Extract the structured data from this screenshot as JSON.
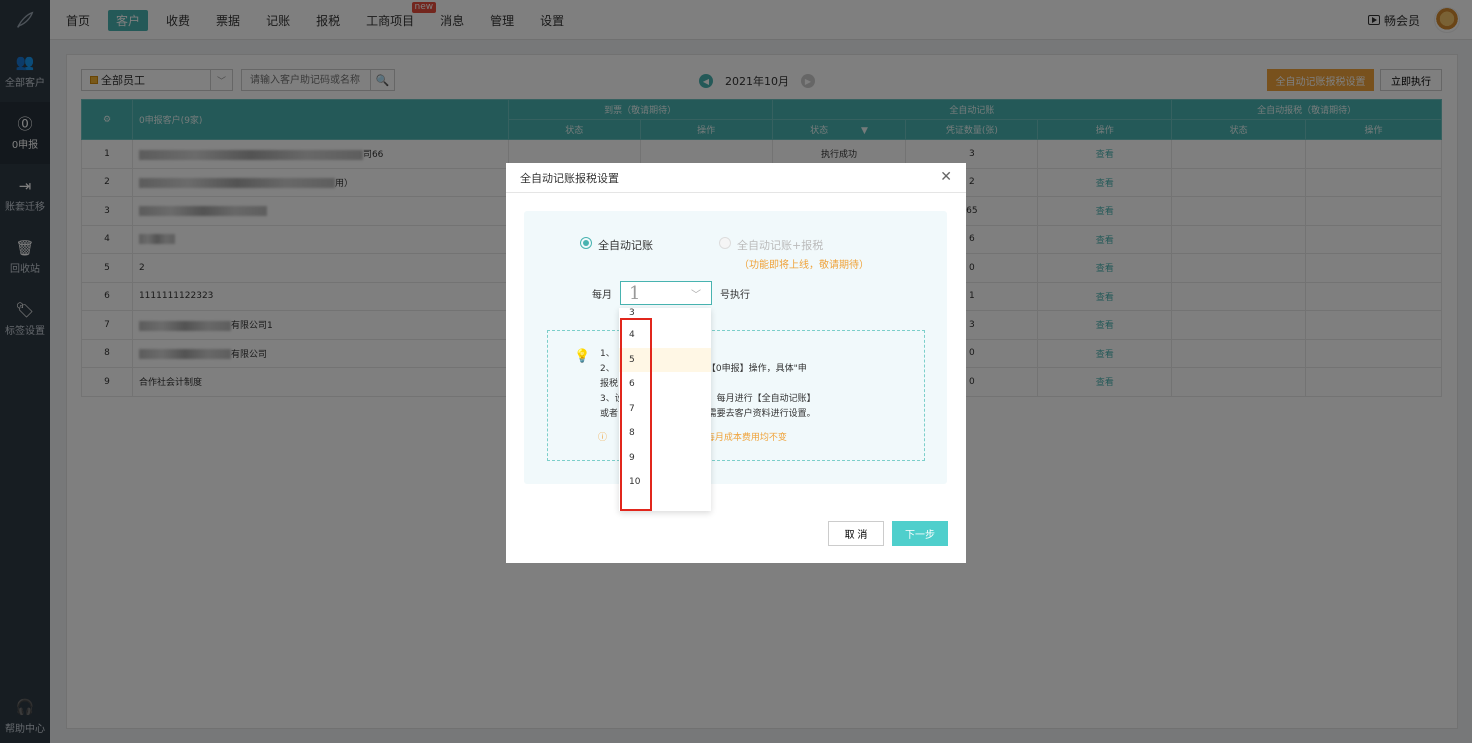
{
  "nav": {
    "items": [
      "首页",
      "客户",
      "收费",
      "票据",
      "记账",
      "报税",
      "工商项目",
      "消息",
      "管理",
      "设置"
    ],
    "active": "客户",
    "new_badge": "new",
    "vip_label": "畅会员"
  },
  "sidebar": {
    "items": [
      {
        "icon": "users-icon",
        "label": "全部客户"
      },
      {
        "icon": "zero-report-icon",
        "label": "0申报"
      },
      {
        "icon": "migrate-icon",
        "label": "账套迁移"
      },
      {
        "icon": "trash-icon",
        "label": "回收站"
      },
      {
        "icon": "tag-icon",
        "label": "标签设置"
      }
    ],
    "active": "0申报",
    "help_label": "帮助中心"
  },
  "toolbar": {
    "staff_select": "全部员工",
    "search_placeholder": "请输入客户助记码或名称",
    "month": "2021年10月",
    "auto_settings_btn": "全自动记账报税设置",
    "run_now_btn": "立即执行"
  },
  "table": {
    "group_headers": [
      "到票（敬请期待）",
      "全自动记账",
      "全自动报税（敬请期待）"
    ],
    "client_header": "0申报客户(9家)",
    "sub_headers": [
      "状态",
      "操作",
      "状态",
      "凭证数量(张)",
      "操作",
      "状态",
      "操作"
    ],
    "rows": [
      {
        "no": "1",
        "name_tail": "司66",
        "status": "执行成功",
        "count": "3",
        "action": "查看"
      },
      {
        "no": "2",
        "name_tail": "用）",
        "status": "",
        "count": "2",
        "action": "查看"
      },
      {
        "no": "3",
        "name_tail": "",
        "status": "",
        "count": "65",
        "action": "查看"
      },
      {
        "no": "4",
        "name_tail": "",
        "status": "",
        "count": "6",
        "action": "查看"
      },
      {
        "no": "5",
        "name_tail": "2",
        "status": "",
        "count": "0",
        "action": "查看"
      },
      {
        "no": "6",
        "name_tail": "1111111122323",
        "status": "",
        "count": "1",
        "action": "查看"
      },
      {
        "no": "7",
        "name_tail": "有限公司1",
        "status": "",
        "count": "3",
        "action": "查看"
      },
      {
        "no": "8",
        "name_tail": "有限公司",
        "status": "",
        "count": "0",
        "action": "查看"
      },
      {
        "no": "9",
        "name_tail": "合作社会计制度",
        "status": "",
        "count": "0",
        "action": "查看"
      }
    ]
  },
  "modal": {
    "title": "全自动记账报税设置",
    "radio_auto": "全自动记账",
    "radio_auto_tax": "全自动记账+报税",
    "radio_auto_tax_note": "（功能即将上线，敬请期待）",
    "day_prefix": "每月",
    "day_value": "1",
    "day_suffix": "号执行",
    "tip_lines": [
      "1、 日期复制上月全部凭证。",
      "2、 日期对\"申报税表\"执行【0申报】操作，具体\"申",
      "报税 税设置]进行配置。",
      "3、设 户都将在设置的时间，每月进行【全自动记账】",
      "或者 如需设置0申报客户，需要去客户资料进行设置。"
    ],
    "warn_text": "每月成本费用均不变",
    "dropdown_options": [
      "3",
      "4",
      "5",
      "6",
      "7",
      "8",
      "9",
      "10"
    ],
    "dropdown_highlight": "5",
    "cancel_btn": "取 消",
    "next_btn": "下一步"
  }
}
